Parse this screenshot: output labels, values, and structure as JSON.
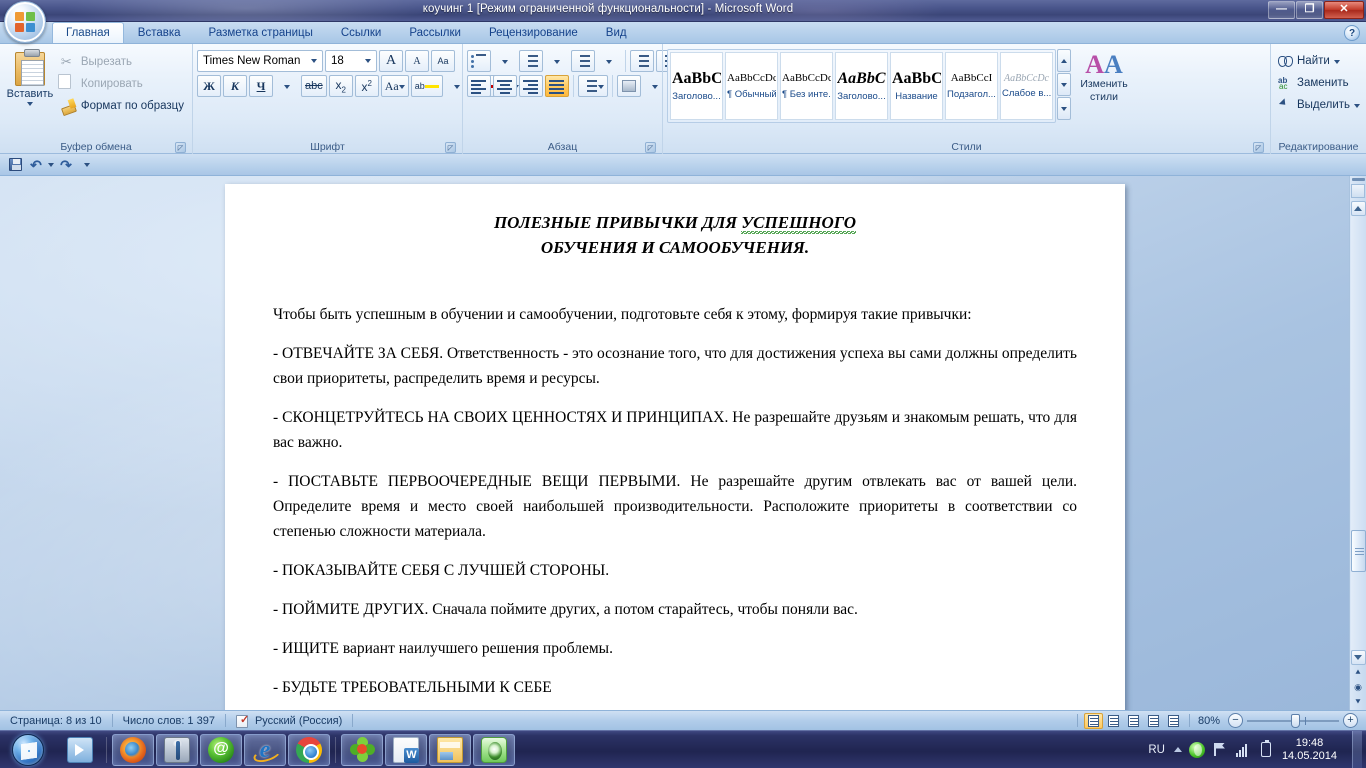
{
  "window": {
    "title": "коучинг 1 [Режим ограниченной функциональности] - Microsoft Word",
    "minimize": "—",
    "restore": "❐",
    "close": "✕",
    "help": "?"
  },
  "qat": {
    "save": "Сохранить",
    "undo": "↶",
    "undo_arrow": "▾",
    "redo": "↷",
    "customize": "▾"
  },
  "tabs": [
    {
      "label": "Главная",
      "active": true
    },
    {
      "label": "Вставка",
      "active": false
    },
    {
      "label": "Разметка страницы",
      "active": false
    },
    {
      "label": "Ссылки",
      "active": false
    },
    {
      "label": "Рассылки",
      "active": false
    },
    {
      "label": "Рецензирование",
      "active": false
    },
    {
      "label": "Вид",
      "active": false
    }
  ],
  "ribbon": {
    "clipboard": {
      "group_label": "Буфер обмена",
      "paste": "Вставить",
      "cut": "Вырезать",
      "copy": "Копировать",
      "format_painter": "Формат по образцу"
    },
    "font": {
      "group_label": "Шрифт",
      "font_name": "Times New Roman",
      "font_size": "18",
      "grow_font": "A",
      "shrink_font": "A",
      "clear_format": "Aa",
      "bold": "Ж",
      "italic": "К",
      "underline": "Ч",
      "strikethrough": "abc",
      "subscript": "x",
      "superscript": "x",
      "change_case": "Aa",
      "highlight": "ab",
      "font_color": "A"
    },
    "paragraph": {
      "group_label": "Абзац",
      "bullets": "Маркеры",
      "numbering": "Нумерация",
      "multilevel": "Многоуровневый список",
      "decrease_indent": "Уменьшить отступ",
      "increase_indent": "Увеличить отступ",
      "sort": "Сортировка",
      "show_marks": "¶",
      "align_left": "По левому краю",
      "align_center": "По центру",
      "align_right": "По правому краю",
      "justify": "По ширине",
      "justify_active": true,
      "line_spacing": "Междустрочный интервал",
      "shading": "Заливка",
      "borders": "Границы"
    },
    "styles": {
      "group_label": "Стили",
      "change_styles": "Изменить\nстили",
      "change_styles_line1": "Изменить",
      "change_styles_line2": "стили",
      "items": [
        {
          "preview": "AaBbC",
          "name": "Заголово...",
          "variant": "bold-big"
        },
        {
          "preview": "AaBbCcDc",
          "name": "¶ Обычный",
          "variant": "normal"
        },
        {
          "preview": "AaBbCcDc",
          "name": "¶ Без инте...",
          "variant": "normal"
        },
        {
          "preview": "AaBbC",
          "name": "Заголово...",
          "variant": "bold-italic"
        },
        {
          "preview": "AaBbC",
          "name": "Название",
          "variant": "bold-big"
        },
        {
          "preview": "AaBbCcI",
          "name": "Подзагол...",
          "variant": "normal"
        },
        {
          "preview": "AaBbCcDc",
          "name": "Слабое в...",
          "variant": "gray-italic"
        }
      ]
    },
    "editing": {
      "group_label": "Редактирование",
      "find": "Найти",
      "replace": "Заменить",
      "select": "Выделить"
    }
  },
  "document": {
    "title_line1_a": "ПОЛЕЗНЫЕ ПРИВЫЧКИ ДЛЯ ",
    "title_line1_b": "УСПЕШНОГО",
    "title_line2": "ОБУЧЕНИЯ И САМООБУЧЕНИЯ.",
    "paragraphs": [
      "Чтобы быть успешным в обучении и самообучении, подготовьте себя к этому, формируя такие привычки:",
      "- ОТВЕЧАЙТЕ ЗА СЕБЯ. Ответственность - это осознание того, что для достижения успеха вы сами должны определить свои приоритеты, распределить время и ресурсы.",
      "- СКОНЦЕТРУЙТЕСЬ НА СВОИХ ЦЕННОСТЯХ И ПРИНЦИПАХ. Не разрешайте друзьям и знакомым решать, что для вас важно.",
      "- ПОСТАВЬТЕ ПЕРВООЧЕРЕДНЫЕ ВЕЩИ ПЕРВЫМИ. Не разрешайте другим отвлекать вас от вашей цели. Определите время и место своей наибольшей производительности. Расположите приоритеты в соответствии со степенью сложности материала.",
      "- ПОКАЗЫВАЙТЕ СЕБЯ С ЛУЧШЕЙ СТОРОНЫ.",
      "- ПОЙМИТЕ ДРУГИХ. Сначала поймите других, а потом старайтесь, чтобы поняли вас.",
      "- ИЩИТЕ вариант наилучшего решения проблемы.",
      "- БУДЬТЕ ТРЕБОВАТЕЛЬНЫМИ К СЕБЕ"
    ]
  },
  "statusbar": {
    "page": "Страница: 8 из 10",
    "words": "Число слов: 1 397",
    "language": "Русский (Россия)",
    "zoom": "80%",
    "zoom_out": "−",
    "zoom_in": "+",
    "views": [
      "Разметка страницы",
      "Режим чтения",
      "Веб-документ",
      "Структура",
      "Черновик"
    ]
  },
  "taskbar": {
    "start": "Пуск",
    "items": [
      {
        "name": "media-player",
        "open": false
      },
      {
        "name": "firefox",
        "open": true
      },
      {
        "name": "tool-app",
        "open": true
      },
      {
        "name": "mail-at",
        "open": true
      },
      {
        "name": "internet-explorer",
        "open": true
      },
      {
        "name": "chrome",
        "open": true
      },
      {
        "name": "icq",
        "open": true
      },
      {
        "name": "word",
        "open": true
      },
      {
        "name": "explorer",
        "open": true
      },
      {
        "name": "green-app",
        "open": true
      }
    ],
    "tray": {
      "language": "RU",
      "time": "19:48",
      "date": "14.05.2014"
    }
  }
}
